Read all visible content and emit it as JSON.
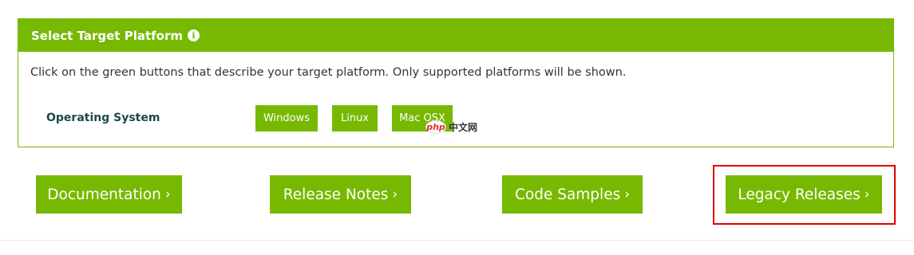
{
  "panel": {
    "title": "Select Target Platform",
    "info_icon": "info-icon",
    "instructions": "Click on the green buttons that describe your target platform. Only supported platforms will be shown.",
    "os_label": "Operating System",
    "os_options": [
      "Windows",
      "Linux",
      "Mac OSX"
    ]
  },
  "watermark": {
    "logo_text": "php",
    "text": "中文网"
  },
  "links": {
    "documentation": "Documentation",
    "release_notes": "Release Notes",
    "code_samples": "Code Samples",
    "legacy_releases": "Legacy Releases",
    "chevron": "›"
  },
  "colors": {
    "brand_green": "#76b900",
    "highlight_red": "#e00000"
  }
}
